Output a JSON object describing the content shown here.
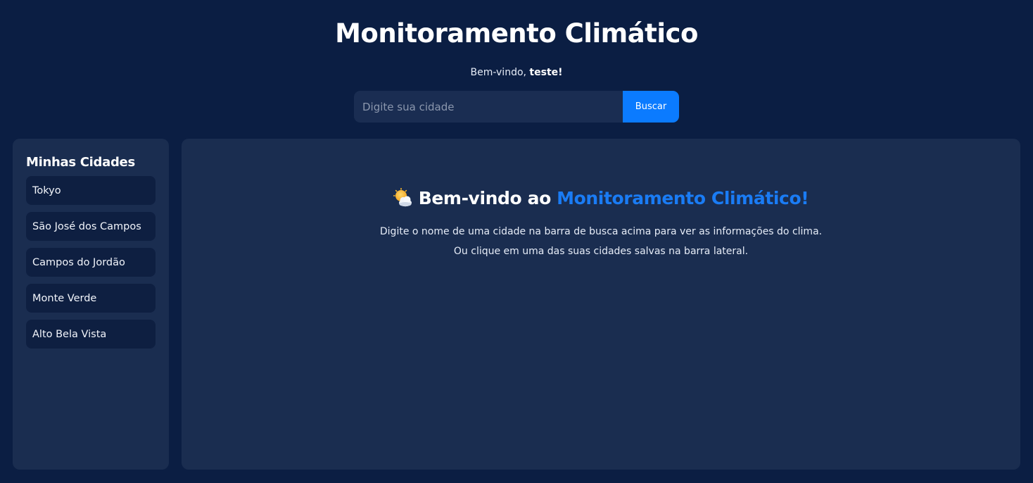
{
  "header": {
    "title": "Monitoramento Climático",
    "welcome_prefix": "Bem-vindo, ",
    "username": "teste!"
  },
  "search": {
    "placeholder": "Digite sua cidade",
    "value": "",
    "button_label": "Buscar"
  },
  "sidebar": {
    "title": "Minhas Cidades",
    "cities": [
      {
        "label": "Tokyo"
      },
      {
        "label": "São José dos Campos"
      },
      {
        "label": "Campos do Jordão"
      },
      {
        "label": "Monte Verde"
      },
      {
        "label": "Alto Bela Vista"
      }
    ]
  },
  "main": {
    "icon": "sun-behind-cloud-icon",
    "heading_prefix": "Bem-vindo ao ",
    "heading_accent": "Monitoramento Climático!",
    "line1": "Digite o nome de uma cidade na barra de busca acima para ver as informações do clima.",
    "line2": "Ou clique em uma das suas cidades salvas na barra lateral."
  },
  "colors": {
    "background": "#0b1e43",
    "panel": "#1a2d50",
    "accent": "#0b7bff",
    "city_item": "#0e1f41"
  }
}
